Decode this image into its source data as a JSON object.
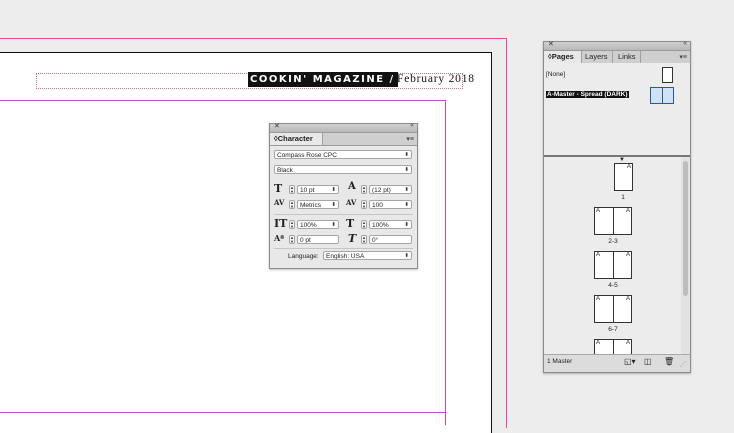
{
  "document": {
    "header_title": "COOKIN' MAGAZINE /",
    "header_date": "February 2018",
    "colors": {
      "bleed": "#e04aa0",
      "margin": "#c04ad0",
      "frame": "#d47070"
    }
  },
  "character_panel": {
    "title": "Character",
    "font_family": "Compass Rose CPC",
    "font_style": "Black",
    "font_size": "10 pt",
    "leading": "(12 pt)",
    "kerning": "Metrics",
    "tracking": "100",
    "vertical_scale": "100%",
    "horizontal_scale": "100%",
    "baseline_shift": "0 pt",
    "skew": "0°",
    "language_label": "Language:",
    "language_value": "English: USA"
  },
  "pages_panel": {
    "tabs": [
      "Pages",
      "Layers",
      "Links"
    ],
    "masters": [
      {
        "label": "[None]"
      },
      {
        "label": "A-Master - Spread (DARK)"
      }
    ],
    "page_labels": [
      "1",
      "2-3",
      "4-5",
      "6-7"
    ],
    "master_prefix": "A",
    "footer_status": "1 Master"
  }
}
